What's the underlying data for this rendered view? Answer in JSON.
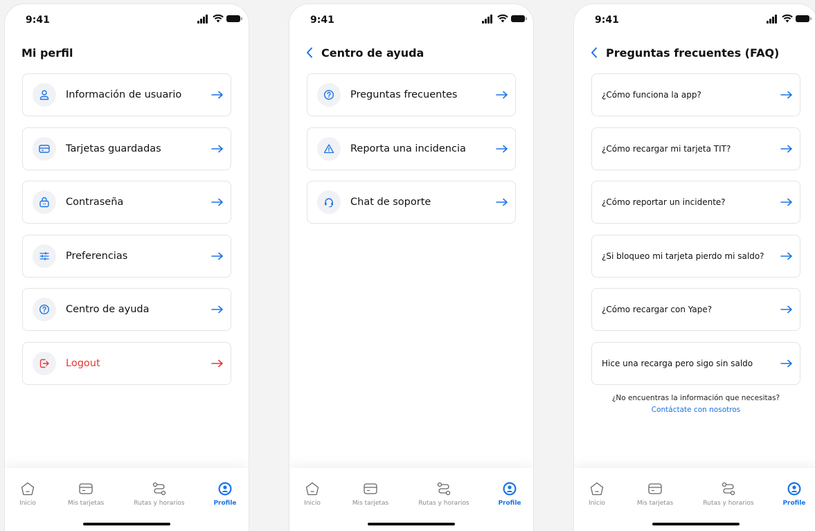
{
  "status": {
    "time": "9:41"
  },
  "screens": [
    {
      "title": "Mi perfil",
      "items": [
        {
          "label": "Información de usuario",
          "icon": "user-icon"
        },
        {
          "label": "Tarjetas guardadas",
          "icon": "card-icon"
        },
        {
          "label": "Contraseña",
          "icon": "lock-icon"
        },
        {
          "label": "Preferencias",
          "icon": "sliders-icon"
        },
        {
          "label": "Centro de ayuda",
          "icon": "help-icon"
        },
        {
          "label": "Logout",
          "icon": "logout-icon"
        }
      ]
    },
    {
      "title": "Centro de ayuda",
      "items": [
        {
          "label": "Preguntas frecuentes",
          "icon": "help-icon"
        },
        {
          "label": "Reporta una incidencia",
          "icon": "warning-icon"
        },
        {
          "label": "Chat de soporte",
          "icon": "headset-icon"
        }
      ]
    },
    {
      "title": "Preguntas frecuentes (FAQ)",
      "items": [
        {
          "label": "¿Cómo funciona la app?"
        },
        {
          "label": "¿Cómo recargar mi tarjeta TIT?"
        },
        {
          "label": "¿Cómo reportar un incidente?"
        },
        {
          "label": "¿Si bloqueo mi tarjeta pierdo mi saldo?"
        },
        {
          "label": "¿Cómo recargar con Yape?"
        },
        {
          "label": "Hice una recarga pero sigo sin saldo"
        }
      ],
      "help_text": "¿No encuentras la información que necesitas?",
      "help_link": "Contáctate con nosotros"
    }
  ],
  "tabbar": {
    "tabs": [
      {
        "label": "Inicio",
        "icon": "home-icon"
      },
      {
        "label": "Mis tarjetas",
        "icon": "card-icon"
      },
      {
        "label": "Rutas y horarios",
        "icon": "route-icon"
      },
      {
        "label": "Profile",
        "icon": "profile-icon"
      }
    ],
    "active": "Profile"
  },
  "colors": {
    "accent": "#1a73e8",
    "danger": "#e53935",
    "border": "#e4e4e4",
    "icon_bg": "#f0f2f5"
  }
}
